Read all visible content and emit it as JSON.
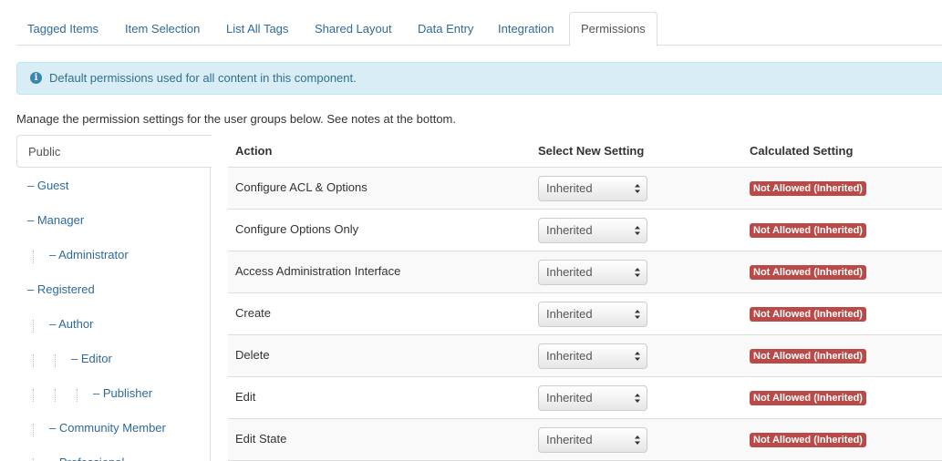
{
  "tabs": [
    {
      "label": "Tagged Items"
    },
    {
      "label": "Item Selection"
    },
    {
      "label": "List All Tags"
    },
    {
      "label": "Shared Layout"
    },
    {
      "label": "Data Entry"
    },
    {
      "label": "Integration"
    },
    {
      "label": "Permissions",
      "active": true
    }
  ],
  "alert": {
    "icon": "info-icon",
    "text": "Default permissions used for all content in this component."
  },
  "intro": "Manage the permission settings for the user groups below. See notes at the bottom.",
  "groups": {
    "selected": "Public",
    "items": [
      {
        "label": "– Guest"
      },
      {
        "label": "– Manager"
      },
      {
        "label": "– Administrator"
      },
      {
        "label": "– Registered"
      },
      {
        "label": "– Author"
      },
      {
        "label": "– Editor"
      },
      {
        "label": "– Publisher"
      },
      {
        "label": "– Community Member"
      },
      {
        "label": "– Professional"
      }
    ]
  },
  "table": {
    "headers": {
      "action": "Action",
      "select": "Select New Setting",
      "calculated": "Calculated Setting"
    },
    "rows": [
      {
        "action": "Configure ACL & Options",
        "setting": "Inherited",
        "calculated": "Not Allowed (Inherited)"
      },
      {
        "action": "Configure Options Only",
        "setting": "Inherited",
        "calculated": "Not Allowed (Inherited)"
      },
      {
        "action": "Access Administration Interface",
        "setting": "Inherited",
        "calculated": "Not Allowed (Inherited)"
      },
      {
        "action": "Create",
        "setting": "Inherited",
        "calculated": "Not Allowed (Inherited)"
      },
      {
        "action": "Delete",
        "setting": "Inherited",
        "calculated": "Not Allowed (Inherited)"
      },
      {
        "action": "Edit",
        "setting": "Inherited",
        "calculated": "Not Allowed (Inherited)"
      },
      {
        "action": "Edit State",
        "setting": "Inherited",
        "calculated": "Not Allowed (Inherited)"
      }
    ]
  },
  "colors": {
    "link": "#2f6a9c",
    "alert_bg": "#d9edf7",
    "badge": "#b94a48"
  }
}
